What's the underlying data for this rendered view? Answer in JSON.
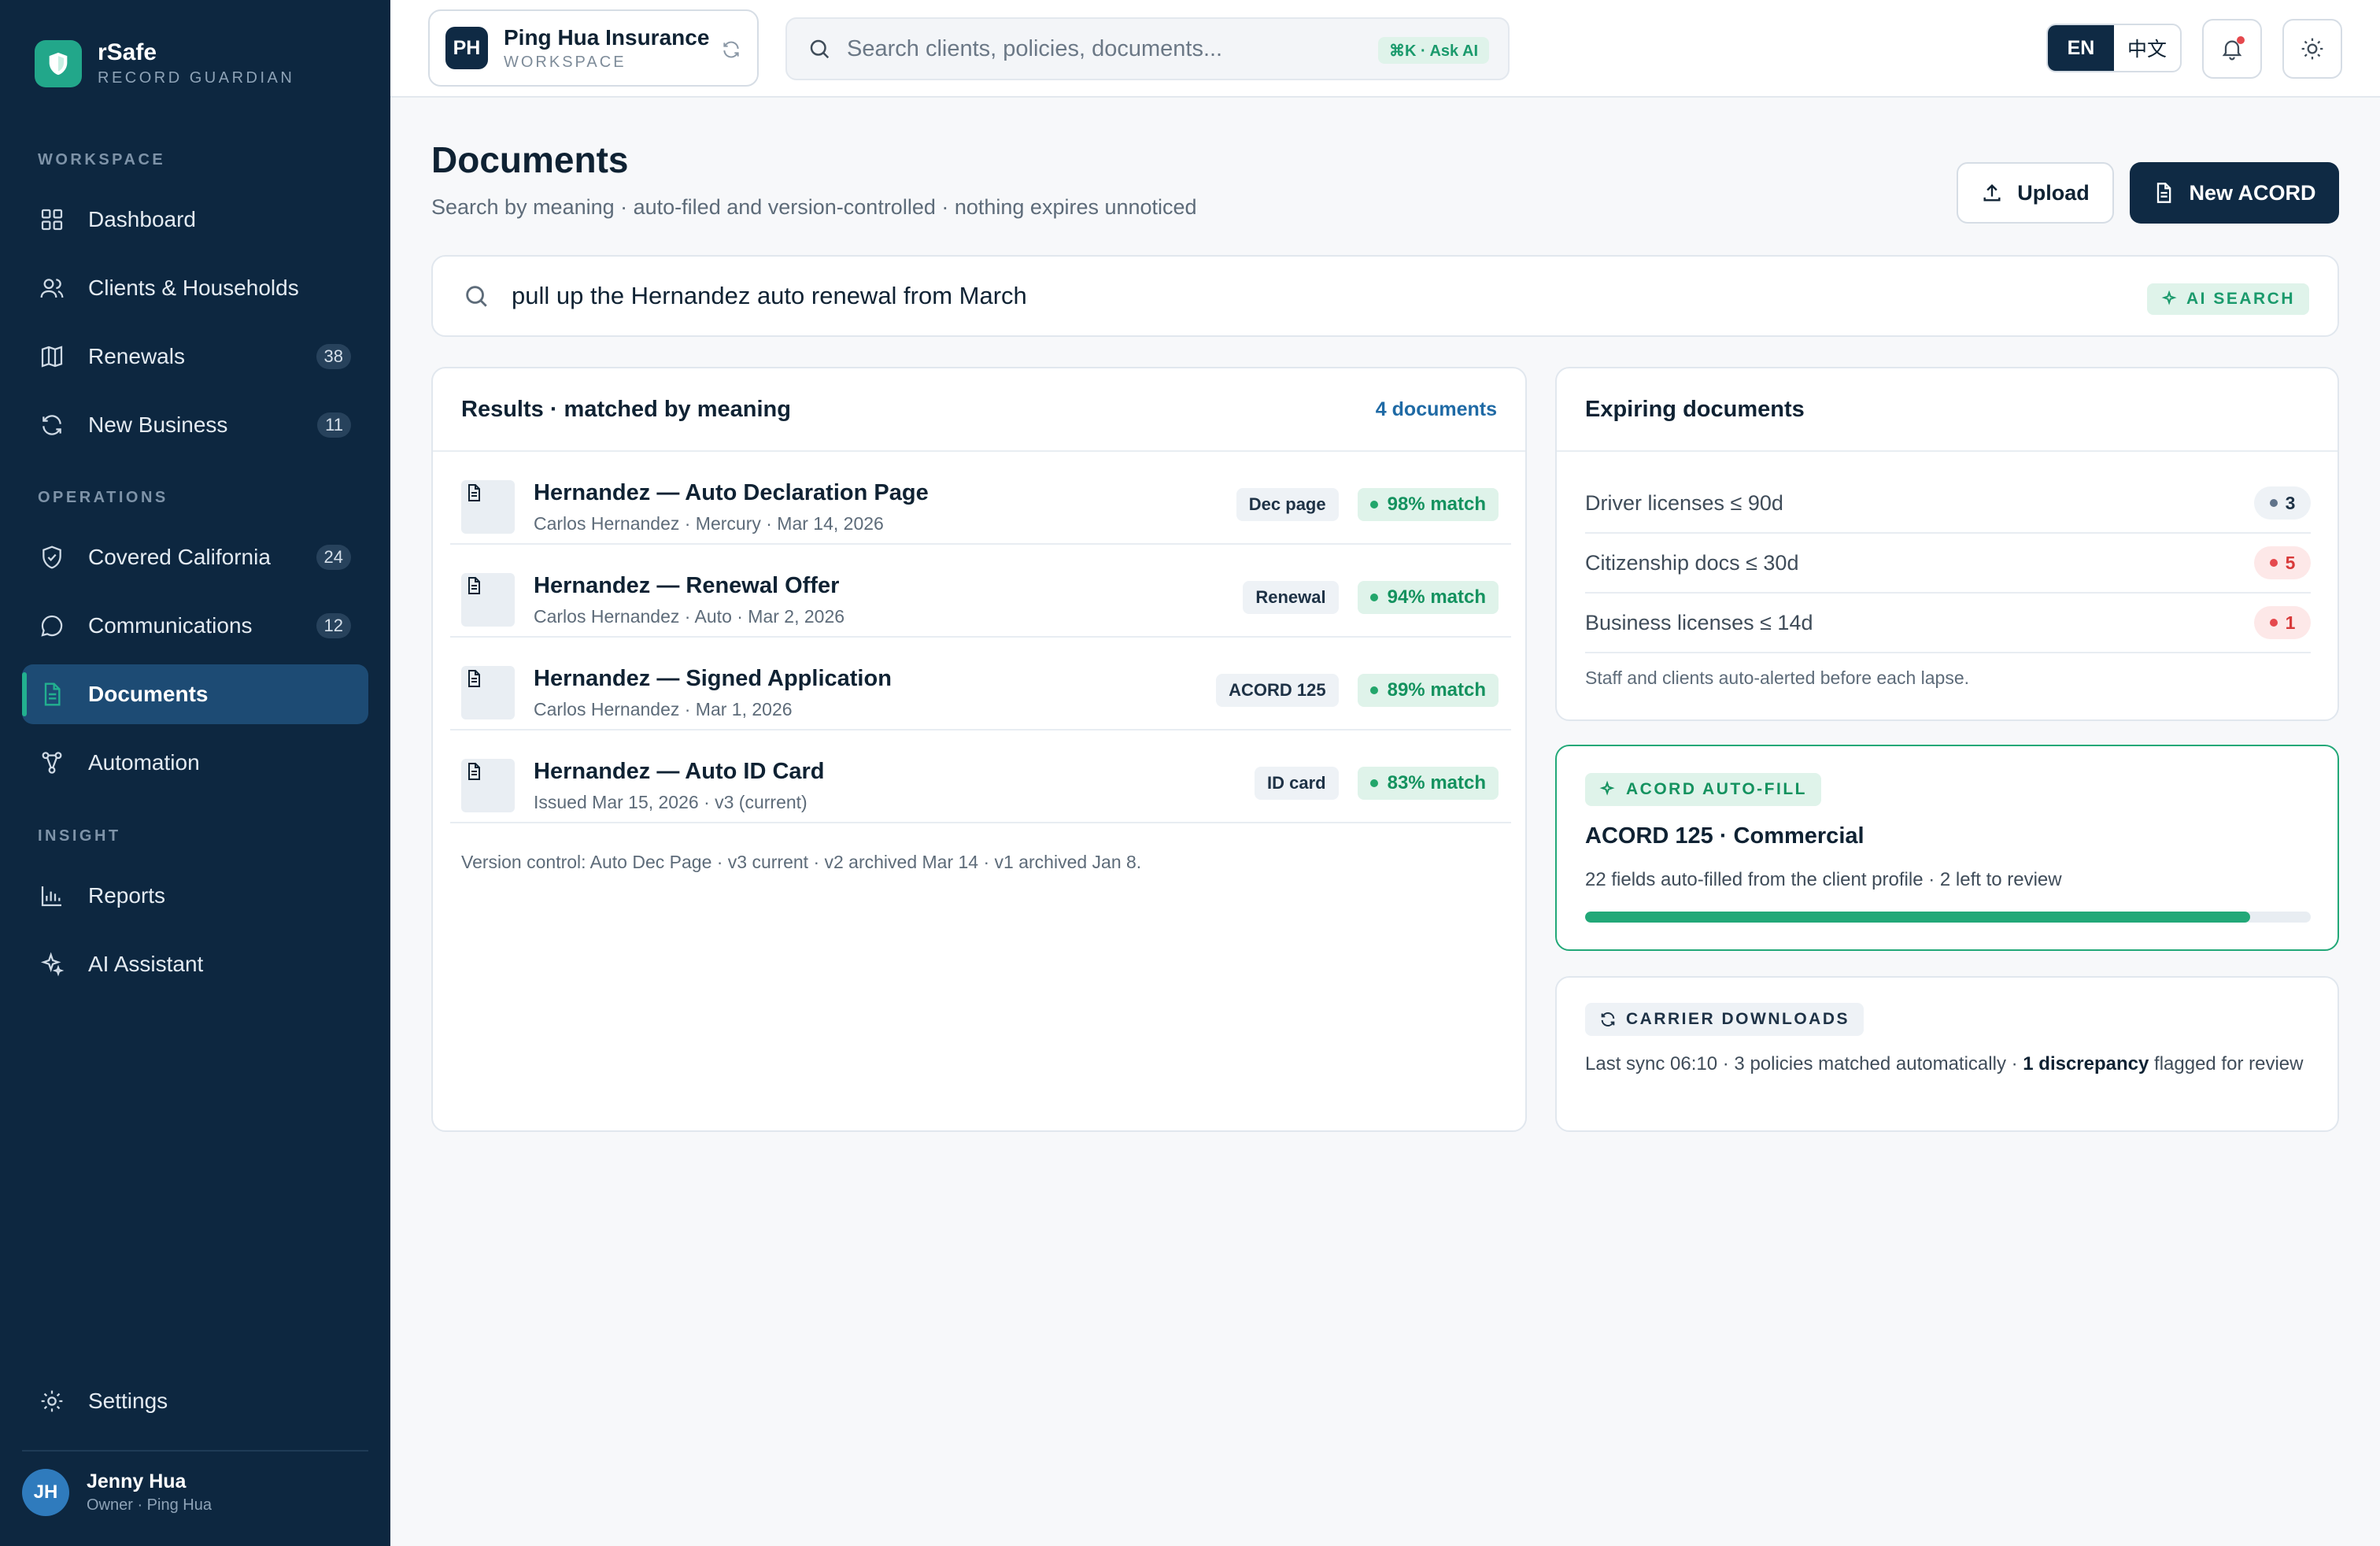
{
  "brand": {
    "name": "rSafe",
    "tagline": "RECORD GUARDIAN"
  },
  "sidebar": {
    "sections": [
      {
        "label": "WORKSPACE",
        "items": [
          {
            "label": "Dashboard",
            "icon": "grid-icon",
            "badge": null
          },
          {
            "label": "Clients & Households",
            "icon": "users-icon",
            "badge": null
          },
          {
            "label": "Renewals",
            "icon": "map-icon",
            "badge": "38"
          },
          {
            "label": "New Business",
            "icon": "refresh-icon",
            "badge": "11"
          }
        ]
      },
      {
        "label": "OPERATIONS",
        "items": [
          {
            "label": "Covered California",
            "icon": "shield-check-icon",
            "badge": "24"
          },
          {
            "label": "Communications",
            "icon": "chat-bubble-icon",
            "badge": "12"
          },
          {
            "label": "Documents",
            "icon": "document-icon",
            "badge": null,
            "active": true
          },
          {
            "label": "Automation",
            "icon": "workflow-icon",
            "badge": null
          }
        ]
      },
      {
        "label": "INSIGHT",
        "items": [
          {
            "label": "Reports",
            "icon": "bar-chart-icon",
            "badge": null
          },
          {
            "label": "AI Assistant",
            "icon": "sparkle-icon",
            "badge": null
          }
        ]
      }
    ],
    "settings_label": "Settings",
    "user": {
      "initials": "JH",
      "name": "Jenny Hua",
      "role": "Owner · Ping Hua"
    }
  },
  "topbar": {
    "workspace": {
      "initials": "PH",
      "name": "Ping Hua Insurance",
      "sub": "WORKSPACE"
    },
    "search": {
      "placeholder": "Search clients, policies, documents...",
      "shortcut": "⌘K · Ask AI"
    },
    "languages": [
      "EN",
      "中文"
    ],
    "active_language": "EN"
  },
  "page": {
    "title": "Documents",
    "subtitle": "Search by meaning · auto-filed and version-controlled · nothing expires unnoticed",
    "upload_label": "Upload",
    "new_acord_label": "New ACORD"
  },
  "query": {
    "text": "pull up the Hernandez auto renewal from March",
    "tag": "AI SEARCH"
  },
  "results": {
    "title": "Results · matched by meaning",
    "count": "4 documents",
    "items": [
      {
        "title": "Hernandez — Auto Declaration Page",
        "meta": "Carlos Hernandez · Mercury · Mar 14, 2026",
        "type": "Dec page",
        "match": "98% match"
      },
      {
        "title": "Hernandez — Renewal Offer",
        "meta": "Carlos Hernandez · Auto · Mar 2, 2026",
        "type": "Renewal",
        "match": "94% match"
      },
      {
        "title": "Hernandez — Signed Application",
        "meta": "Carlos Hernandez · Mar 1, 2026",
        "type": "ACORD 125",
        "match": "89% match"
      },
      {
        "title": "Hernandez — Auto ID Card",
        "meta": "Issued Mar 15, 2026 · v3 (current)",
        "type": "ID card",
        "match": "83% match"
      }
    ],
    "version_note": "Version control: Auto Dec Page · v3 current · v2 archived Mar 14 · v1 archived Jan 8."
  },
  "expiring": {
    "title": "Expiring documents",
    "rows": [
      {
        "label": "Driver licenses ≤ 90d",
        "count": "3",
        "status": "neutral"
      },
      {
        "label": "Citizenship docs ≤ 30d",
        "count": "5",
        "status": "alert"
      },
      {
        "label": "Business licenses ≤ 14d",
        "count": "1",
        "status": "alert"
      }
    ],
    "note": "Staff and clients auto-alerted before each lapse."
  },
  "acord": {
    "tag": "ACORD AUTO-FILL",
    "title": "ACORD 125 · Commercial",
    "desc": "22 fields auto-filled from the client profile · 2 left to review",
    "progress": 0.917
  },
  "carrier": {
    "tag": "CARRIER DOWNLOADS",
    "text_before": "Last sync 06:10 · 3 policies matched automatically · ",
    "text_bold": "1 discrepancy",
    "text_after": " flagged for review"
  },
  "colors": {
    "sidebar_bg": "#0d2740",
    "accent_green": "#22a878",
    "primary_navy": "#0f2a44",
    "alert_red": "#e5484d"
  }
}
